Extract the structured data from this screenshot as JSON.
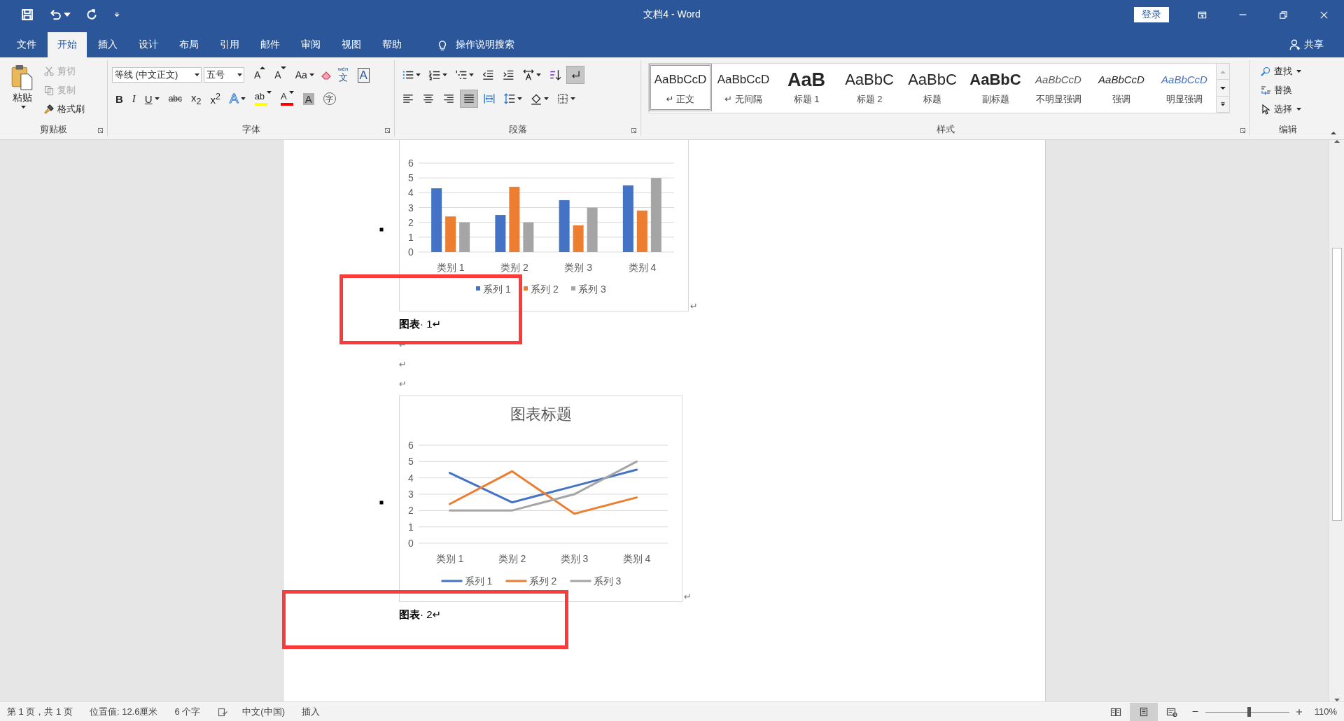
{
  "window": {
    "title": "文档4  -  Word",
    "login": "登录"
  },
  "tabs": [
    {
      "label": "文件",
      "selected": false
    },
    {
      "label": "开始",
      "selected": true
    },
    {
      "label": "插入",
      "selected": false
    },
    {
      "label": "设计",
      "selected": false
    },
    {
      "label": "布局",
      "selected": false
    },
    {
      "label": "引用",
      "selected": false
    },
    {
      "label": "邮件",
      "selected": false
    },
    {
      "label": "审阅",
      "selected": false
    },
    {
      "label": "视图",
      "selected": false
    },
    {
      "label": "帮助",
      "selected": false
    }
  ],
  "search": {
    "placeholder": "操作说明搜索"
  },
  "share": "共享",
  "clipboard": {
    "label": "剪贴板",
    "paste": "粘贴",
    "items": [
      {
        "label": "剪切",
        "disabled": true
      },
      {
        "label": "复制",
        "disabled": true
      },
      {
        "label": "格式刷",
        "disabled": false
      }
    ]
  },
  "font": {
    "label": "字体",
    "name": "等线 (中文正文)",
    "size": "五号",
    "row1": [
      {
        "kind": "grow",
        "label": "A"
      },
      {
        "kind": "shrink",
        "label": "A"
      },
      {
        "kind": "case",
        "label": "Aa"
      },
      {
        "kind": "clear"
      },
      {
        "kind": "phonetic",
        "label": "文",
        "ruby": "wén"
      },
      {
        "kind": "border",
        "label": "A"
      }
    ],
    "row2": [
      {
        "kind": "bold",
        "label": "B"
      },
      {
        "kind": "italic",
        "label": "I"
      },
      {
        "kind": "underline",
        "label": "U"
      },
      {
        "kind": "strike",
        "label": "abc"
      },
      {
        "kind": "plain",
        "label": "x$_{2}$"
      },
      {
        "kind": "plain",
        "label": "x$^{2}$"
      },
      {
        "kind": "effects",
        "label": "A"
      },
      {
        "kind": "highlight",
        "label": "ab",
        "color": "#ffff00"
      },
      {
        "kind": "color",
        "label": "A",
        "color": "#ff0000"
      },
      {
        "kind": "shading",
        "label": "A"
      },
      {
        "kind": "enclose",
        "label": "字"
      }
    ]
  },
  "paragraph": {
    "label": "段落",
    "buttons": [
      {
        "on": false
      },
      {
        "on": false
      },
      {
        "on": false
      },
      {
        "on": false
      },
      {
        "on": false
      },
      {
        "on": false
      },
      {
        "on": false
      },
      {
        "on": true
      },
      {
        "on": false
      },
      {
        "on": false
      },
      {
        "on": false
      },
      {
        "on": true
      },
      {
        "on": false
      },
      {
        "on": false
      },
      {
        "on": false
      },
      {
        "on": false
      }
    ]
  },
  "styles": {
    "label": "样式",
    "items": [
      {
        "kind": "normal",
        "sample": "AaBbCcD",
        "name": "↵ 正文",
        "selected": true
      },
      {
        "kind": "normal",
        "sample": "AaBbCcD",
        "name": "↵ 无间隔",
        "selected": false
      },
      {
        "kind": "heading1",
        "sample": "AaB",
        "name": "标题 1",
        "selected": false
      },
      {
        "kind": "heading2",
        "sample": "AaBbC",
        "name": "标题 2",
        "selected": false
      },
      {
        "kind": "title",
        "sample": "AaBbC",
        "name": "标题",
        "selected": false
      },
      {
        "kind": "subtitle",
        "sample": "AaBbC",
        "name": "副标题",
        "selected": false
      },
      {
        "kind": "subtle",
        "sample": "AaBbCcD",
        "name": "不明显强调",
        "selected": false
      },
      {
        "kind": "emphasis",
        "sample": "AaBbCcD",
        "name": "强调",
        "selected": false
      },
      {
        "kind": "intense",
        "sample": "AaBbCcD",
        "name": "明显强调",
        "selected": false
      }
    ]
  },
  "editing": {
    "label": "编辑",
    "items": [
      {
        "kind": "find",
        "label": "查找"
      },
      {
        "kind": "replace",
        "label": "替换"
      },
      {
        "kind": "select",
        "label": "选择"
      }
    ]
  },
  "document": {
    "blocks": [
      {
        "kind": "chart",
        "end_mark": "↵",
        "chart_data": {
          "type": "bar",
          "grid": true,
          "legend": true,
          "categories": [
            "类别 1",
            "类别 2",
            "类别 3",
            "类别 4"
          ],
          "yticks": [
            0,
            1,
            2,
            3,
            4,
            5,
            6
          ],
          "ylim": [
            0,
            6
          ],
          "series": [
            {
              "name": "系列 1",
              "color": "#4472c4",
              "values": [
                4.3,
                2.5,
                3.5,
                4.5
              ]
            },
            {
              "name": "系列 2",
              "color": "#ed7d31",
              "values": [
                2.4,
                4.4,
                1.8,
                2.8
              ]
            },
            {
              "name": "系列 3",
              "color": "#a5a5a5",
              "values": [
                2,
                2,
                3,
                5
              ]
            }
          ]
        }
      },
      {
        "kind": "caption",
        "text": "**图表**· 1↵",
        "highlighted": true
      },
      {
        "kind": "mark",
        "text": "↵"
      },
      {
        "kind": "mark",
        "text": "↵"
      },
      {
        "kind": "mark",
        "text": "↵"
      },
      {
        "kind": "chart",
        "end_mark": "↵",
        "chart_data": {
          "type": "line",
          "title": "图表标题",
          "grid": true,
          "legend": true,
          "categories": [
            "类别 1",
            "类别 2",
            "类别 3",
            "类别 4"
          ],
          "yticks": [
            0,
            1,
            2,
            3,
            4,
            5,
            6
          ],
          "ylim": [
            0,
            6
          ],
          "series": [
            {
              "name": "系列 1",
              "color": "#4472c4",
              "values": [
                4.3,
                2.5,
                3.5,
                4.5
              ]
            },
            {
              "name": "系列 2",
              "color": "#ed7d31",
              "values": [
                2.4,
                4.4,
                1.8,
                2.8
              ]
            },
            {
              "name": "系列 3",
              "color": "#a5a5a5",
              "values": [
                2,
                2,
                3,
                5
              ]
            }
          ]
        }
      },
      {
        "kind": "caption",
        "text": "**图表**· 2↵",
        "highlighted": true
      }
    ]
  },
  "status_bar": {
    "page": "第 1 页，共 1 页",
    "position": "位置值: 12.6厘米",
    "words": "6 个字",
    "language": "中文(中国)",
    "mode": "插入",
    "views": [
      {
        "selected": false
      },
      {
        "selected": true
      },
      {
        "selected": false
      }
    ],
    "zoom": {
      "level": 0.52,
      "reading": "110%"
    }
  }
}
